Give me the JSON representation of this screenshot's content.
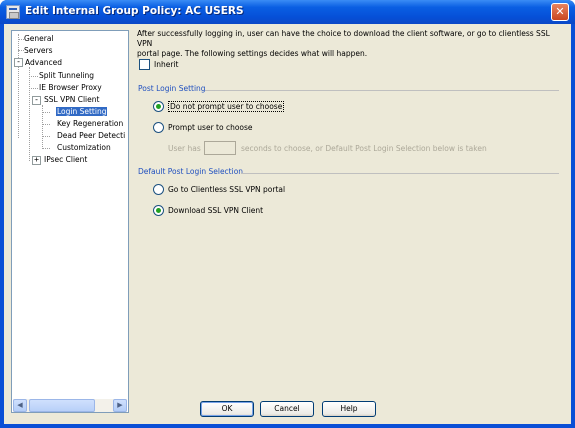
{
  "window": {
    "title": "Edit Internal Group Policy: AC USERS",
    "close_glyph": "✕"
  },
  "tree": {
    "items": [
      {
        "label": "General",
        "level": 0
      },
      {
        "label": "Servers",
        "level": 0
      },
      {
        "label": "Advanced",
        "level": 0,
        "expander": "-"
      },
      {
        "label": "Split Tunneling",
        "level": 1
      },
      {
        "label": "IE Browser Proxy",
        "level": 1
      },
      {
        "label": "SSL VPN Client",
        "level": 1,
        "expander": "-"
      },
      {
        "label": "Login Setting",
        "level": 2,
        "selected": true
      },
      {
        "label": "Key Regeneration",
        "level": 2
      },
      {
        "label": "Dead Peer Detecti",
        "level": 2
      },
      {
        "label": "Customization",
        "level": 2
      },
      {
        "label": "IPsec Client",
        "level": 1,
        "expander": "+"
      }
    ],
    "scroll_left_glyph": "◀",
    "scroll_right_glyph": "▶"
  },
  "main": {
    "description_line1": "After successfully logging in, user can have the choice to download the client software, or go to clientless SSL VPN",
    "description_line2": "portal page. The following settings decides what will happen.",
    "inherit_label": "Inherit",
    "inherit_checked": false,
    "post_login": {
      "title": "Post Login Setting",
      "option1": "Do not prompt user to choose",
      "option1_checked": true,
      "option2": "Prompt user to choose",
      "option2_checked": false,
      "user_has_text": "User has",
      "seconds_text": "seconds to choose, or Default Post Login Selection below is taken",
      "seconds_value": ""
    },
    "default_post_login": {
      "title": "Default Post Login Selection",
      "option1": "Go to Clientless SSL VPN portal",
      "option1_checked": false,
      "option2": "Download SSL VPN Client",
      "option2_checked": true
    }
  },
  "buttons": {
    "ok": "OK",
    "cancel": "Cancel",
    "help": "Help"
  },
  "colors": {
    "titlebar": "#0a5fe3",
    "dialog_bg": "#ece9d8",
    "section_title": "#1f4fbf",
    "selection": "#316ac5",
    "radio_dot": "#21a121"
  }
}
